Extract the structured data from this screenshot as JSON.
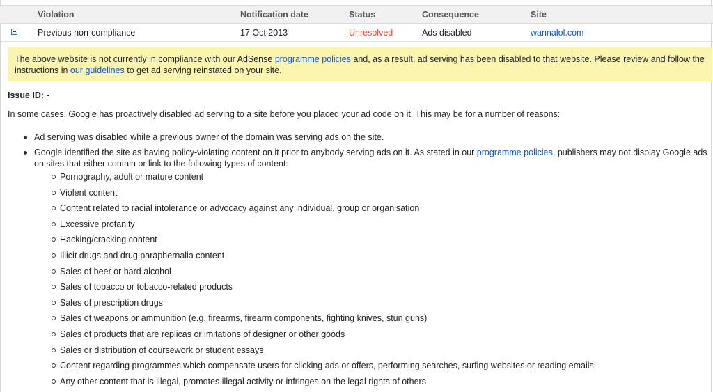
{
  "table": {
    "headers": {
      "violation": "Violation",
      "notification_date": "Notification date",
      "status": "Status",
      "consequence": "Consequence",
      "site": "Site"
    },
    "row": {
      "violation": "Previous non-compliance",
      "notification_date": "17 Oct 2013",
      "status": "Unresolved",
      "consequence": "Ads disabled",
      "site": "wannalol.com",
      "expand_icon": "minus-box-icon"
    }
  },
  "notice": {
    "part1": "The above website is not currently in compliance with our AdSense ",
    "link1": "programme policies",
    "part2": " and, as a result, ad serving has been disabled to that website. Please review and follow the instructions in ",
    "link2": "our guidelines",
    "part3": " to get ad serving reinstated on your site."
  },
  "issue": {
    "label": "Issue ID:",
    "value": " -"
  },
  "intro": "In some cases, Google has proactively disabled ad serving to a site before you placed your ad code on it. This may be for a number of reasons:",
  "reasons": {
    "first": "Ad serving was disabled while a previous owner of the domain was serving ads on the site.",
    "second_part1": "Google identified the site as having policy-violating content on it prior to anybody serving ads on it. As stated in our ",
    "second_link": "programme policies",
    "second_part2": ", publishers may not display Google ads on sites that either contain or link to the following types of content:"
  },
  "content_types": [
    "Pornography, adult or mature content",
    "Violent content",
    "Content related to racial intolerance or advocacy against any individual, group or organisation",
    "Excessive profanity",
    "Hacking/cracking content",
    "Illicit drugs and drug paraphernalia content",
    "Sales of beer or hard alcohol",
    "Sales of tobacco or tobacco-related products",
    "Sales of prescription drugs",
    "Sales of weapons or ammunition (e.g. firearms, firearm components, fighting knives, stun guns)",
    "Sales of products that are replicas or imitations of designer or other goods",
    "Sales or distribution of coursework or student essays",
    "Content regarding programmes which compensate users for clicking ads or offers, performing searches, surfing websites or reading emails",
    "Any other content that is illegal, promotes illegal activity or infringes on the legal rights of others"
  ],
  "colors": {
    "notice_bg": "#fbf5b0",
    "link": "#1155cc",
    "status_unresolved": "#dd4b39",
    "header_bg": "#f1f1f1"
  }
}
